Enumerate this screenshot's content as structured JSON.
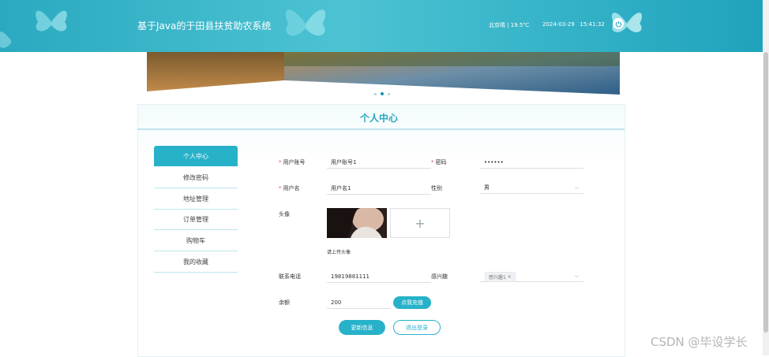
{
  "header": {
    "site_title": "基于Java的于田县扶贫助农系统",
    "weather": "北京晴 | 19.5℃",
    "date": "2024-03-29",
    "time": "15:41:32",
    "power_icon": "power-icon"
  },
  "carousel": {
    "slide_count": 3,
    "active_index": 1
  },
  "page": {
    "title": "个人中心"
  },
  "sidebar": {
    "items": [
      {
        "label": "个人中心",
        "active": true
      },
      {
        "label": "修改密码",
        "active": false
      },
      {
        "label": "地址管理",
        "active": false
      },
      {
        "label": "订单管理",
        "active": false
      },
      {
        "label": "购物车",
        "active": false
      },
      {
        "label": "我的收藏",
        "active": false
      }
    ]
  },
  "form": {
    "account": {
      "label": "用户账号",
      "value": "用户账号1",
      "required": true
    },
    "password": {
      "label": "密码",
      "value": "••••••",
      "required": true
    },
    "username": {
      "label": "用户名",
      "value": "用户名1",
      "required": true
    },
    "gender": {
      "label": "性别",
      "value": "男"
    },
    "avatar": {
      "label": "头像",
      "upload_hint": "请上传头像"
    },
    "phone": {
      "label": "联系电话",
      "value": "19819881111"
    },
    "interest": {
      "label": "感兴趣",
      "tag": "感兴趣1"
    },
    "balance": {
      "label": "余额",
      "value": "200",
      "recharge_label": "点我充值"
    }
  },
  "actions": {
    "update_label": "更新信息",
    "logout_label": "退出登录"
  },
  "watermark": "CSDN @毕设学长",
  "colors": {
    "accent": "#27b2c9",
    "header": "#2aa9c0",
    "required": "#e3504e"
  }
}
